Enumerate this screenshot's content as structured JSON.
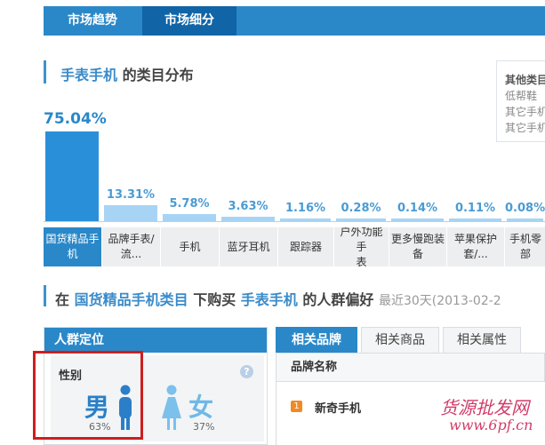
{
  "tabs": [
    "市场趋势",
    "市场细分"
  ],
  "section1": {
    "keyword": "手表手机",
    "title_suffix": "的类目分布"
  },
  "info_box": {
    "heading": "其他类目",
    "lines": [
      "低帮鞋",
      "其它手机",
      "其它手机"
    ]
  },
  "chart_data": {
    "type": "bar",
    "categories": [
      "国货精品手机",
      "品牌手表/流...",
      "手机",
      "蓝牙耳机",
      "跟踪器",
      "户外功能手表",
      "更多慢跑装备",
      "苹果保护套/...",
      "手机零部件"
    ],
    "values": [
      75.04,
      13.31,
      5.78,
      3.63,
      1.16,
      0.28,
      0.14,
      0.11,
      0.08
    ],
    "value_labels": [
      "75.04%",
      "13.31%",
      "5.78%",
      "3.63%",
      "1.16%",
      "0.28%",
      "0.14%",
      "0.11%",
      "0.08%"
    ],
    "selected_index": 0,
    "ylim": [
      0,
      75.04
    ],
    "colors": {
      "selected": "#2a8fd9",
      "normal": "#a7d4f5"
    }
  },
  "category_labels": [
    "国货精品手\n机",
    "品牌手表/\n流...",
    "手机",
    "蓝牙耳机",
    "跟踪器",
    "户外功能手\n表",
    "更多慢跑装\n备",
    "苹果保护\n套/...",
    "手机零部"
  ],
  "section2": {
    "prefix": "在",
    "category": "国货精品手机类目",
    "middle": "下购买",
    "keyword": "手表手机",
    "suffix": "的人群偏好",
    "date_range": "最近30天(2013-02-2"
  },
  "persona": {
    "header": "人群定位",
    "gender_label": "性别",
    "help": "?",
    "male_label": "男",
    "male_pct": "63%",
    "female_label": "女",
    "female_pct": "37%"
  },
  "related": {
    "tabs": [
      "相关品牌",
      "相关商品",
      "相关属性"
    ],
    "column_header": "品牌名称",
    "rows": [
      {
        "rank": "1",
        "name": "新奇手机"
      }
    ]
  },
  "watermark": {
    "line1": "货源批发网",
    "line2": "www.6pf.cn"
  }
}
